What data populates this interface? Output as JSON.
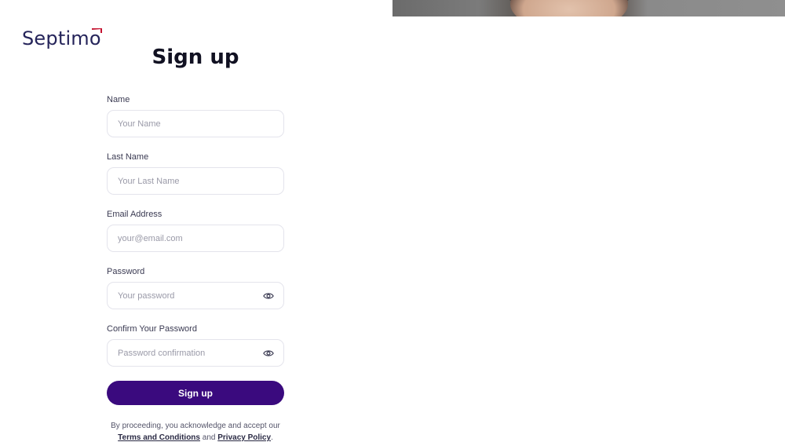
{
  "brand": {
    "name": "Septimo",
    "accent_color": "#c4122f",
    "text_color": "#25245a"
  },
  "page": {
    "title": "Sign up"
  },
  "form": {
    "fields": [
      {
        "label": "Name",
        "placeholder": "Your Name",
        "value": ""
      },
      {
        "label": "Last Name",
        "placeholder": "Your Last Name",
        "value": ""
      },
      {
        "label": "Email Address",
        "placeholder": "your@email.com",
        "value": ""
      },
      {
        "label": "Password",
        "placeholder": "Your password",
        "value": "",
        "icon": "eye-icon"
      },
      {
        "label": "Confirm Your Password",
        "placeholder": "Password confirmation",
        "value": "",
        "icon": "eye-icon"
      }
    ],
    "submit_label": "Sign up",
    "submit_color": "#3a0a7e"
  },
  "legal": {
    "prefix": "By proceeding, you acknowledge and accept our",
    "terms_label": "Terms and Conditions",
    "middle": "and",
    "privacy_label": "Privacy Policy",
    "suffix": "."
  }
}
